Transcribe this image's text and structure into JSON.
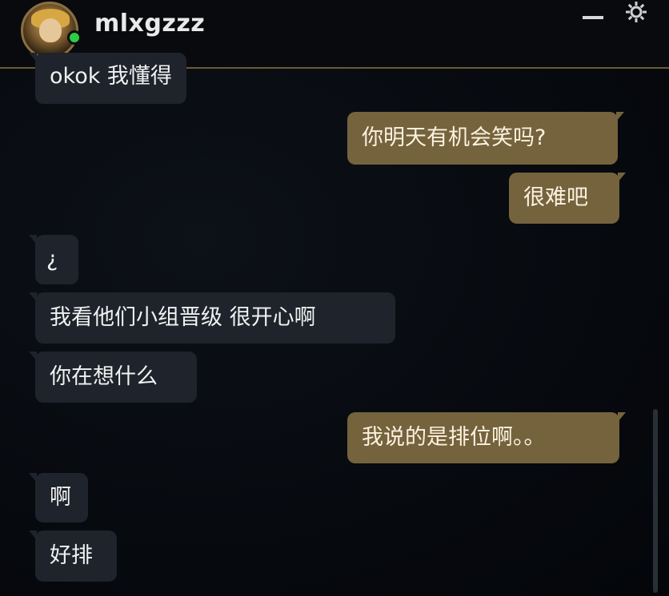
{
  "header": {
    "username": "mlxgzzz",
    "status": "online",
    "status_color": "#2ecc40",
    "actions": [
      "minimize-icon",
      "gear-icon"
    ]
  },
  "colors": {
    "incoming_bubble": "#1e232c",
    "outgoing_bubble": "#75633e",
    "divider": "#6b5a33"
  },
  "messages": [
    {
      "direction": "incoming",
      "text": "okok 我懂得"
    },
    {
      "direction": "outgoing",
      "text": "你明天有机会笑吗?"
    },
    {
      "direction": "outgoing",
      "text": "很难吧"
    },
    {
      "direction": "incoming",
      "text": "¿"
    },
    {
      "direction": "incoming",
      "text": "我看他们小组晋级 很开心啊"
    },
    {
      "direction": "incoming",
      "text": "你在想什么"
    },
    {
      "direction": "outgoing",
      "text": "我说的是排位啊。。"
    },
    {
      "direction": "incoming",
      "text": "啊"
    },
    {
      "direction": "incoming",
      "text": "好排"
    }
  ]
}
